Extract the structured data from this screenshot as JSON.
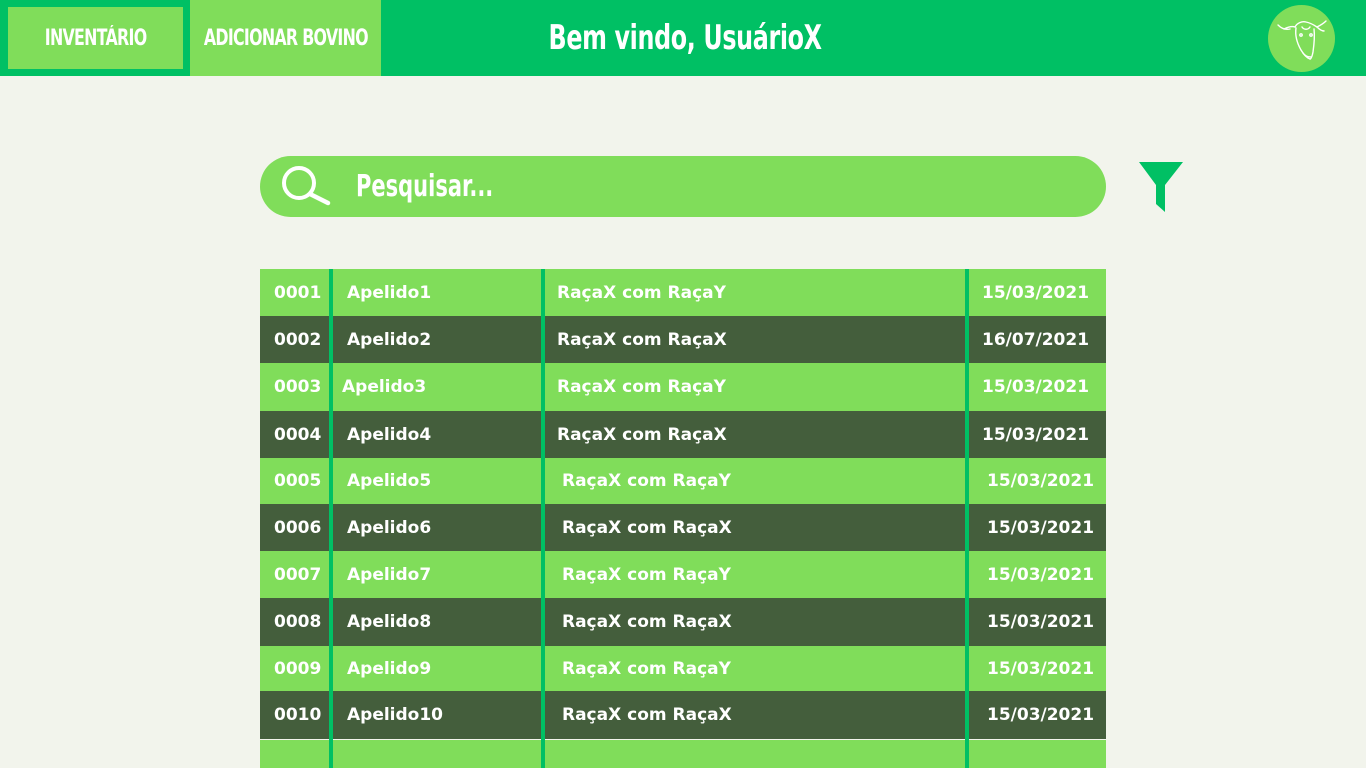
{
  "header": {
    "nav": {
      "inventory_label": "INVENTÁRIO",
      "add_label": "ADICIONAR BOVINO"
    },
    "welcome": "Bem vindo, UsuárioX",
    "logo_icon": "cow-head-icon"
  },
  "search": {
    "placeholder": "Pesquisar...",
    "value": "",
    "icon": "search-icon"
  },
  "filter": {
    "icon": "filter-icon"
  },
  "table": {
    "rows": [
      {
        "id": "0001",
        "name": "Apelido1",
        "breed": "RaçaX com RaçaY",
        "date": "15/03/2021"
      },
      {
        "id": "0002",
        "name": "Apelido2",
        "breed": "RaçaX com RaçaX",
        "date": "16/07/2021"
      },
      {
        "id": "0003",
        "name": "Apelido3",
        "breed": "RaçaX com RaçaY",
        "date": "15/03/2021"
      },
      {
        "id": "0004",
        "name": "Apelido4",
        "breed": "RaçaX com RaçaX",
        "date": "15/03/2021"
      },
      {
        "id": "0005",
        "name": "Apelido5",
        "breed": "RaçaX com RaçaY",
        "date": "15/03/2021"
      },
      {
        "id": "0006",
        "name": "Apelido6",
        "breed": "RaçaX com RaçaX",
        "date": "15/03/2021"
      },
      {
        "id": "0007",
        "name": "Apelido7",
        "breed": "RaçaX com RaçaY",
        "date": "15/03/2021"
      },
      {
        "id": "0008",
        "name": "Apelido8",
        "breed": "RaçaX com RaçaX",
        "date": "15/03/2021"
      },
      {
        "id": "0009",
        "name": "Apelido9",
        "breed": "RaçaX com RaçaY",
        "date": "15/03/2021"
      },
      {
        "id": "0010",
        "name": "Apelido10",
        "breed": "RaçaX com RaçaX",
        "date": "15/03/2021"
      }
    ]
  },
  "colors": {
    "header_green": "#00c064",
    "light_green": "#80dd5a",
    "dark_green": "#445e3c",
    "background": "#f2f4ec"
  }
}
